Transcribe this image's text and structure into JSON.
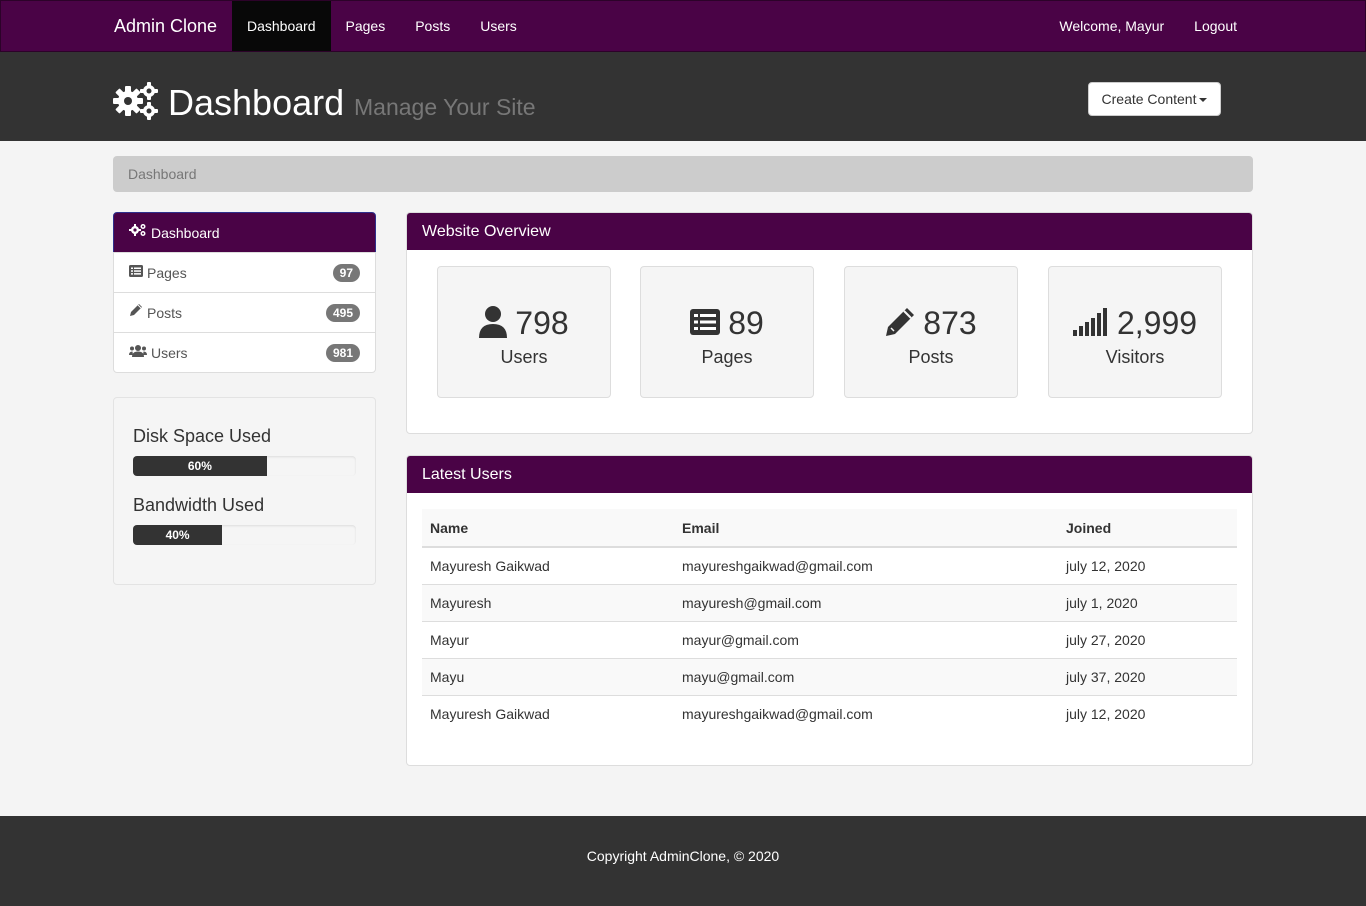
{
  "nav": {
    "brand": "Admin Clone",
    "links": [
      "Dashboard",
      "Pages",
      "Posts",
      "Users"
    ],
    "welcome": "Welcome, Mayur",
    "logout": "Logout"
  },
  "header": {
    "title": "Dashboard",
    "subtitle": "Manage Your Site",
    "create_button": "Create Content"
  },
  "breadcrumb": "Dashboard",
  "sidebar": {
    "items": [
      {
        "label": "Dashboard",
        "icon": "gears-icon"
      },
      {
        "label": "Pages",
        "icon": "list-icon",
        "badge": "97"
      },
      {
        "label": "Posts",
        "icon": "pencil-icon",
        "badge": "495"
      },
      {
        "label": "Users",
        "icon": "users-icon",
        "badge": "981"
      }
    ]
  },
  "usage": {
    "disk_label": "Disk Space Used",
    "disk_value": "60%",
    "disk_fraction": 0.6,
    "bandwidth_label": "Bandwidth Used",
    "bandwidth_value": "40%",
    "bandwidth_fraction": 0.4
  },
  "overview": {
    "title": "Website Overview",
    "tiles": [
      {
        "value": "798",
        "label": "Users",
        "icon": "user-icon"
      },
      {
        "value": "89",
        "label": "Pages",
        "icon": "list-icon"
      },
      {
        "value": "873",
        "label": "Posts",
        "icon": "pencil-icon"
      },
      {
        "value": "2,999",
        "label": "Visitors",
        "icon": "signal-icon"
      }
    ]
  },
  "latest_users": {
    "title": "Latest Users",
    "columns": [
      "Name",
      "Email",
      "Joined"
    ],
    "rows": [
      [
        "Mayuresh Gaikwad",
        "mayureshgaikwad@gmail.com",
        "july 12, 2020"
      ],
      [
        "Mayuresh",
        "mayuresh@gmail.com",
        "july 1, 2020"
      ],
      [
        "Mayur",
        "mayur@gmail.com",
        "july 27, 2020"
      ],
      [
        "Mayu",
        "mayu@gmail.com",
        "july 37, 2020"
      ],
      [
        "Mayuresh Gaikwad",
        "mayureshgaikwad@gmail.com",
        "july 12, 2020"
      ]
    ]
  },
  "footer": "Copyright AdminClone, © 2020",
  "colors": {
    "brand": "#4a0346",
    "dark": "#333333"
  }
}
